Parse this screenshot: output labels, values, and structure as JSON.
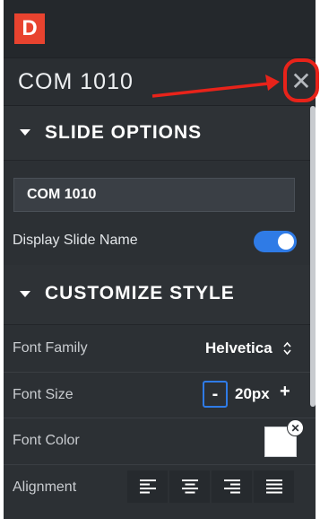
{
  "app": {
    "logo_letter": "D",
    "logo_color": "#e8432f",
    "accent_color": "#2f7be6"
  },
  "header": {
    "slide_title": "COM 1010",
    "close_icon": "close-icon"
  },
  "slide_options": {
    "header_label": "SLIDE OPTIONS",
    "slide_name_value": "COM 1010",
    "display_name_label": "Display Slide Name",
    "display_name_on": true
  },
  "customize_style": {
    "header_label": "CUSTOMIZE STYLE",
    "font_family_label": "Font Family",
    "font_family_value": "Helvetica",
    "font_size_label": "Font Size",
    "font_size_minus": "-",
    "font_size_value": "20px",
    "font_size_plus": "+",
    "font_color_label": "Font Color",
    "font_color_value": "#ffffff",
    "alignment_label": "Alignment",
    "alignment_options": [
      "align-left-icon",
      "align-center-icon",
      "align-right-icon",
      "align-justify-icon"
    ]
  },
  "annotation": {
    "color": "#e8231a"
  }
}
